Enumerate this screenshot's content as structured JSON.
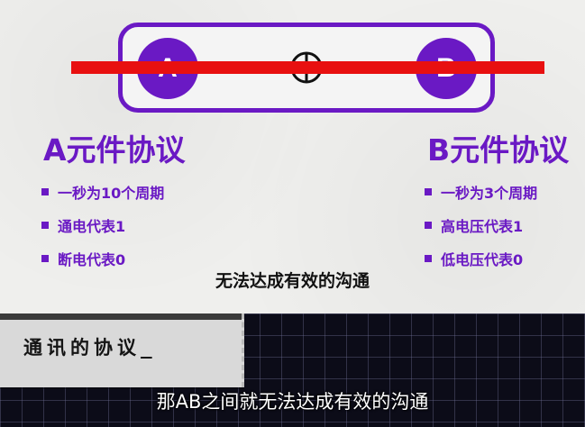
{
  "diagram": {
    "node_a": "A",
    "node_b": "B"
  },
  "protocol_a": {
    "title": "A元件协议",
    "bullets": [
      "一秒为10个周期",
      "通电代表1",
      "断电代表0"
    ]
  },
  "protocol_b": {
    "title": "B元件协议",
    "bullets": [
      "一秒为3个周期",
      "高电压代表1",
      "低电压代表0"
    ]
  },
  "conclusion": "无法达成有效的沟通",
  "section_tag": "通讯的协议_",
  "subtitle": "那AB之间就无法达成有效的沟通",
  "colors": {
    "accent": "#6a19c4",
    "block_line": "#e81010"
  },
  "icons": {
    "center": "circle-cross-icon"
  }
}
